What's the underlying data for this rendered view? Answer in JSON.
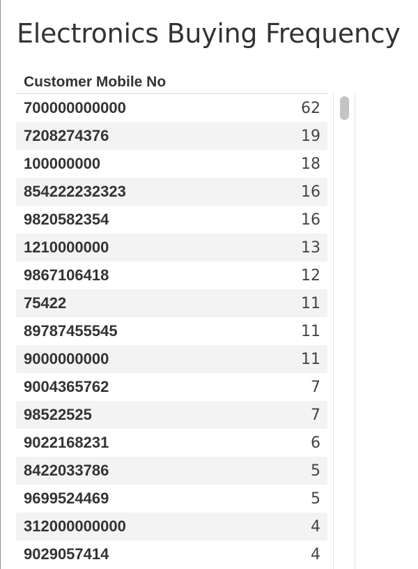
{
  "title": "Electronics Buying Frequency",
  "table": {
    "column_header": "Customer Mobile No",
    "rows": [
      {
        "phone": "700000000000",
        "count": "62"
      },
      {
        "phone": "7208274376",
        "count": "19"
      },
      {
        "phone": "100000000",
        "count": "18"
      },
      {
        "phone": "854222232323",
        "count": "16"
      },
      {
        "phone": "9820582354",
        "count": "16"
      },
      {
        "phone": "1210000000",
        "count": "13"
      },
      {
        "phone": "9867106418",
        "count": "12"
      },
      {
        "phone": "75422",
        "count": "11"
      },
      {
        "phone": "89787455545",
        "count": "11"
      },
      {
        "phone": "9000000000",
        "count": "11"
      },
      {
        "phone": "9004365762",
        "count": "7"
      },
      {
        "phone": "98522525",
        "count": "7"
      },
      {
        "phone": "9022168231",
        "count": "6"
      },
      {
        "phone": "8422033786",
        "count": "5"
      },
      {
        "phone": "9699524469",
        "count": "5"
      },
      {
        "phone": "312000000000",
        "count": "4"
      },
      {
        "phone": "9029057414",
        "count": "4"
      }
    ]
  },
  "colors": {
    "text": "#333333",
    "row_alt_background": "#f3f3f3",
    "scroll_thumb": "#c4c4c4"
  }
}
